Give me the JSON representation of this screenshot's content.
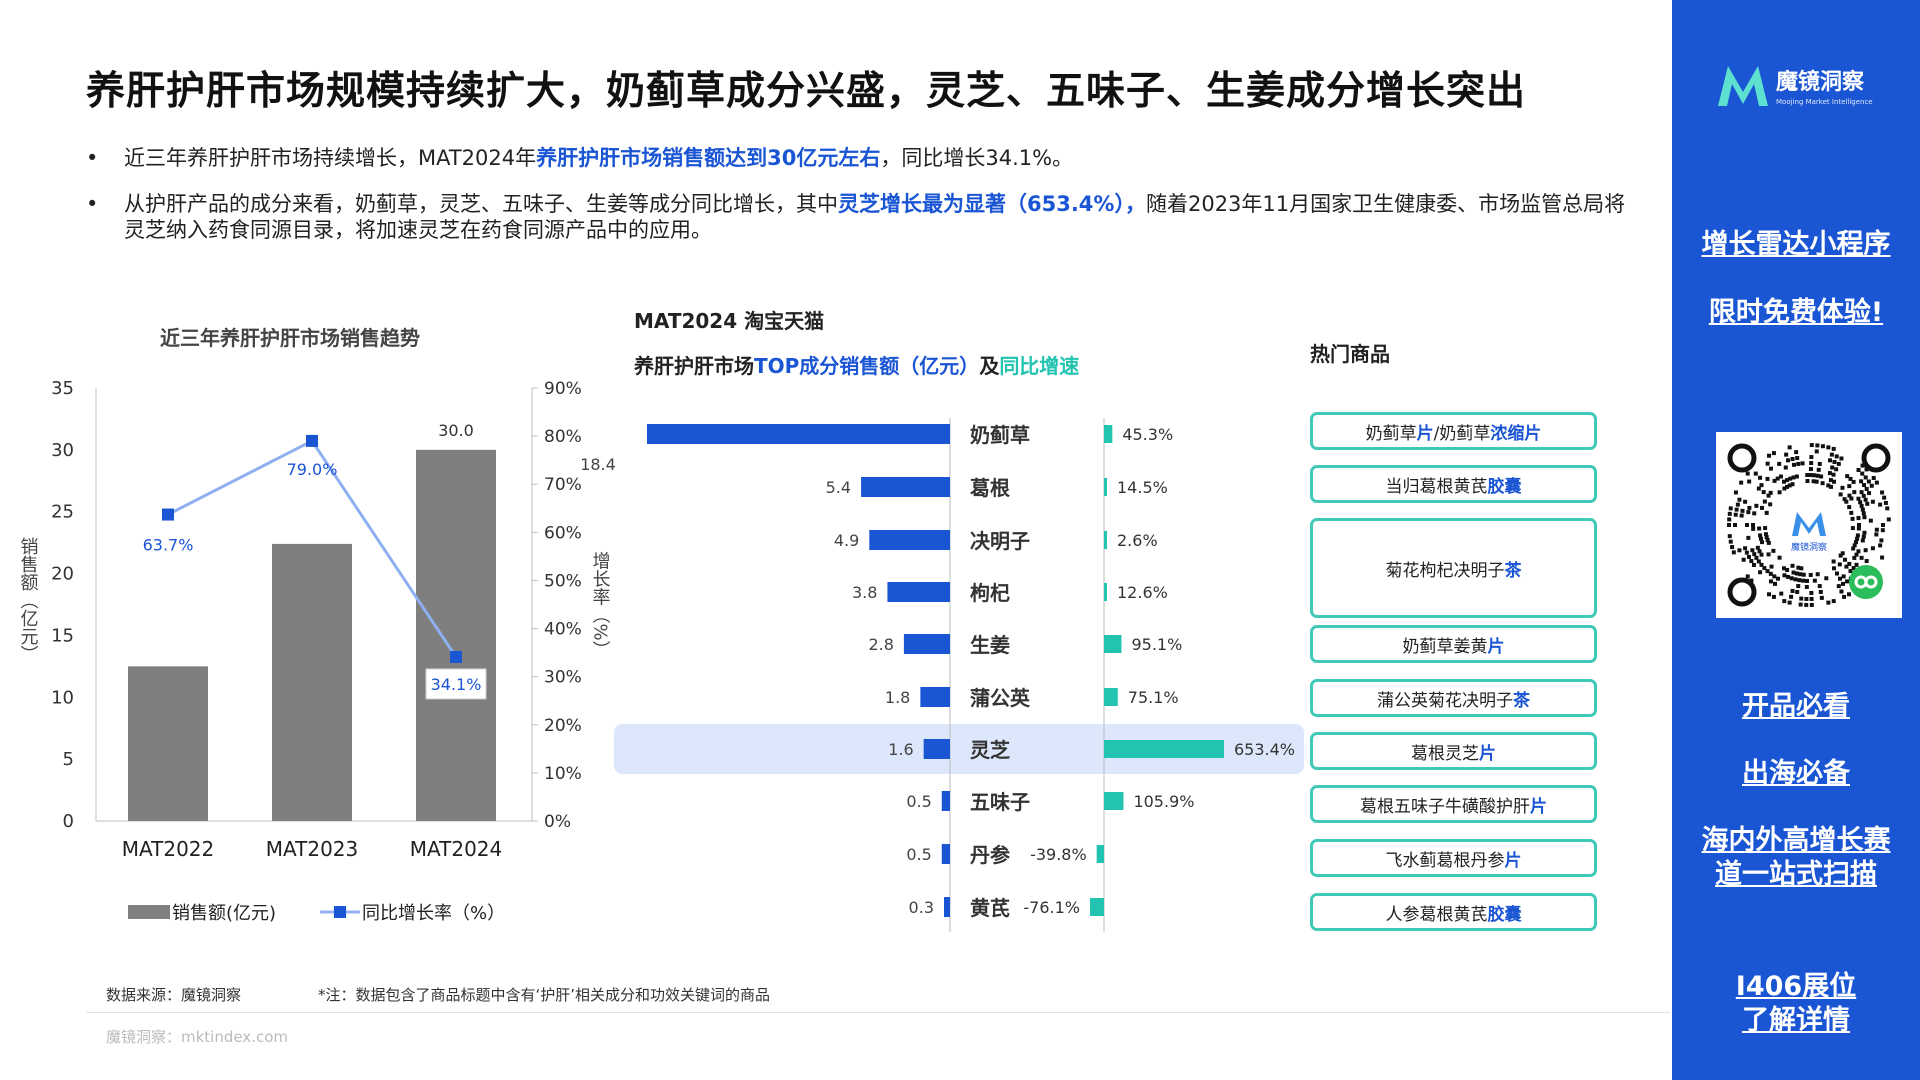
{
  "title": "养肝护肝市场规模持续扩大，奶蓟草成分兴盛，灵芝、五味子、生姜成分增长突出",
  "bullets": [
    {
      "dot": "•",
      "pre": "近三年养肝护肝市场持续增长，MAT2024年",
      "hl": "养肝护肝市场销售额达到30亿元左右",
      "post": "，同比增长34.1%。"
    },
    {
      "dot": "•",
      "pre": "从护肝产品的成分来看，奶蓟草，灵芝、五味子、生姜等成分同比增长，其中",
      "hl": "灵芝增长最为显著（653.4%），",
      "post": "随着2023年11月国家卫生健康委、市场监管总局将灵芝纳入药食同源目录，将加速灵芝在药食同源产品中的应用。"
    }
  ],
  "sidebar": {
    "logo_name": "魔镜洞察",
    "logo_sub": "Moojing Market Intelligence",
    "qr_label": "魔镜洞察",
    "links": [
      {
        "text": "增长雷达小程序"
      },
      {
        "text": "限时免费体验!"
      },
      {
        "text": "开品必看"
      },
      {
        "text": "出海必备"
      },
      {
        "text": "海内外高增长赛道一站式扫描"
      },
      {
        "text": "I406展位了解详情"
      }
    ]
  },
  "left_chart_title": "近三年养肝护肝市场销售趋势",
  "mid_chart": {
    "title_line1": "MAT2024 淘宝天猫",
    "title_a": "养肝护肝市场",
    "title_b": "TOP成分销售额（亿元）",
    "title_c": "及",
    "title_d": "同比增速"
  },
  "products_title": "热门商品",
  "products": [
    {
      "pre": "奶蓟草",
      "mid": "片",
      "post": "/奶蓟草",
      "hl": "浓缩片"
    },
    {
      "pre": "当归葛根黄芪",
      "hl": "胶囊"
    },
    {
      "pre": "菊花枸杞决明子",
      "hl": "茶"
    },
    {
      "pre": "奶蓟草姜黄",
      "hl": "片"
    },
    {
      "pre": "蒲公英菊花决明子",
      "hl": "茶"
    },
    {
      "pre": "葛根灵芝",
      "hl": "片"
    },
    {
      "pre": "葛根五味子牛磺酸护肝",
      "hl": "片"
    },
    {
      "pre": "飞水蓟葛根丹参",
      "hl": "片"
    },
    {
      "pre": "人参葛根黄芪",
      "hl": "胶囊"
    }
  ],
  "footer": {
    "source": "数据来源：魔镜洞察",
    "note": "*注：数据包含了商品标题中含有‘护肝’相关成分和功效关键词的商品",
    "site": "魔镜洞察：mktindex.com"
  },
  "colors": {
    "accent": "#1a55d4",
    "teal": "#22c3b0",
    "bar_gray": "#7f7f7f",
    "line_blue": "#8fb0f0",
    "highlight_row": "#dde7fb"
  },
  "chart_data": [
    {
      "type": "bar",
      "title": "近三年养肝护肝市场销售趋势",
      "categories": [
        "MAT2022",
        "MAT2023",
        "MAT2024"
      ],
      "series": [
        {
          "name": "销售额(亿元)",
          "type": "bar",
          "axis": "left",
          "values": [
            12.5,
            22.4,
            30.0
          ],
          "labels": [
            "",
            "",
            "30.0"
          ]
        },
        {
          "name": "同比增长率（%）",
          "type": "line",
          "axis": "right",
          "values": [
            63.7,
            79.0,
            34.1
          ],
          "labels": [
            "63.7%",
            "79.0%",
            "34.1%"
          ]
        }
      ],
      "ylabel": "销售额（亿元）",
      "y2label": "增长率（%）",
      "ylim": [
        0,
        35
      ],
      "yticks": [
        "0",
        "5",
        "10",
        "15",
        "20",
        "25",
        "30",
        "35"
      ],
      "y2lim": [
        0,
        90
      ],
      "y2ticks": [
        "0%",
        "10%",
        "20%",
        "30%",
        "40%",
        "50%",
        "60%",
        "70%",
        "80%",
        "90%"
      ],
      "legend": "bottom",
      "grid": false
    },
    {
      "type": "bar",
      "orientation": "horizontal",
      "title": "养肝护肝市场TOP成分销售额（亿元）及同比增速",
      "categories": [
        "奶蓟草",
        "葛根",
        "决明子",
        "枸杞",
        "生姜",
        "蒲公英",
        "灵芝",
        "五味子",
        "丹参",
        "黄芪"
      ],
      "series": [
        {
          "name": "销售额（亿元）",
          "values": [
            18.4,
            5.4,
            4.9,
            3.8,
            2.8,
            1.8,
            1.6,
            0.5,
            0.5,
            0.3
          ],
          "labels": [
            "18.4",
            "5.4",
            "4.9",
            "3.8",
            "2.8",
            "1.8",
            "1.6",
            "0.5",
            "0.5",
            "0.3"
          ]
        },
        {
          "name": "同比增速",
          "values": [
            45.3,
            14.5,
            2.6,
            12.6,
            95.1,
            75.1,
            653.4,
            105.9,
            -39.8,
            -76.1
          ],
          "labels": [
            "45.3%",
            "14.5%",
            "2.6%",
            "12.6%",
            "95.1%",
            "75.1%",
            "653.4%",
            "105.9%",
            "-39.8%",
            "-76.1%"
          ]
        }
      ],
      "highlight": "灵芝"
    }
  ]
}
